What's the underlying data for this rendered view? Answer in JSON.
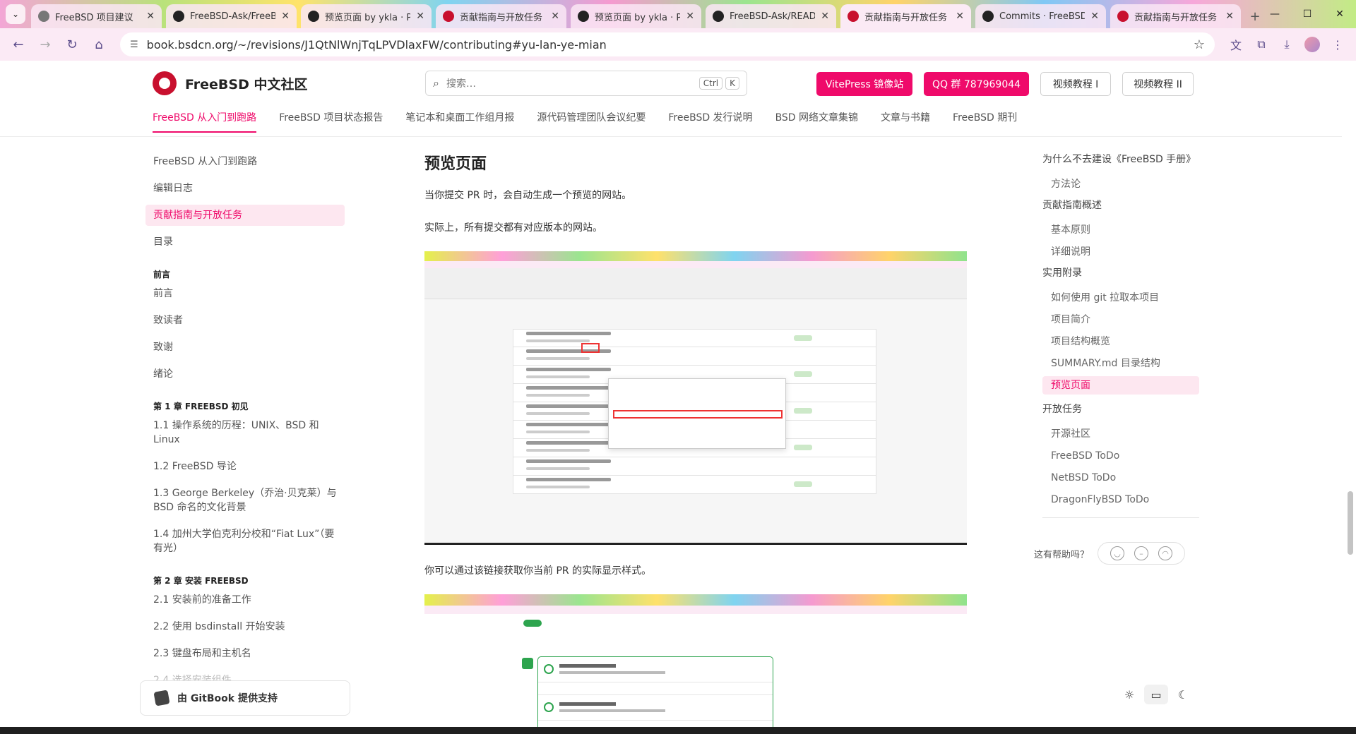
{
  "browser": {
    "tabs": [
      {
        "title": "FreeBSD 项目建议",
        "icon": "globe",
        "active": false
      },
      {
        "title": "FreeBSD-Ask/FreeB",
        "icon": "github",
        "active": false
      },
      {
        "title": "预览页面 by ykla · P",
        "icon": "github",
        "active": false
      },
      {
        "title": "贡献指南与开放任务",
        "icon": "freebsd",
        "active": false
      },
      {
        "title": "预览页面 by ykla · P",
        "icon": "github",
        "active": false
      },
      {
        "title": "FreeBSD-Ask/READ",
        "icon": "github",
        "active": false
      },
      {
        "title": "贡献指南与开放任务",
        "icon": "freebsd",
        "active": true
      },
      {
        "title": "Commits · FreeBSD",
        "icon": "github",
        "active": false
      },
      {
        "title": "贡献指南与开放任务",
        "icon": "freebsd",
        "active": false
      }
    ],
    "url": "book.bsdcn.org/~/revisions/J1QtNlWnjTqLPVDlaxFW/contributing#yu-lan-ye-mian"
  },
  "header": {
    "site_name": "FreeBSD 中文社区",
    "search_placeholder": "搜索…",
    "search_kbd_ctrl": "Ctrl",
    "search_kbd_k": "K",
    "btn_vitepress": "VitePress 镜像站",
    "btn_qq": "QQ 群 787969044",
    "btn_video1": "视频教程 I",
    "btn_video2": "视频教程 II",
    "nav": [
      "FreeBSD 从入门到跑路",
      "FreeBSD 项目状态报告",
      "笔记本和桌面工作组月报",
      "源代码管理团队会议纪要",
      "FreeBSD 发行说明",
      "BSD 网络文章集锦",
      "文章与书籍",
      "FreeBSD 期刊"
    ]
  },
  "sidebar": {
    "top_items": [
      "FreeBSD 从入门到跑路",
      "编辑日志",
      "贡献指南与开放任务",
      "目录"
    ],
    "sec_preface": "前言",
    "preface_items": [
      "前言",
      "致读者",
      "致谢",
      "绪论"
    ],
    "sec_ch1": "第 1 章 FREEBSD 初见",
    "ch1_items": [
      "1.1 操作系统的历程：UNIX、BSD 和 Linux",
      "1.2 FreeBSD 导论",
      "1.3 George Berkeley（乔治·贝克莱）与 BSD 命名的文化背景",
      "1.4 加州大学伯克利分校和“Fiat Lux”（要有光）"
    ],
    "sec_ch2": "第 2 章 安装 FREEBSD",
    "ch2_items": [
      "2.1 安装前的准备工作",
      "2.2 使用 bsdinstall 开始安装",
      "2.3 键盘布局和主机名",
      "2.4 选择安装组件"
    ],
    "gitbook": "由 GitBook 提供支持"
  },
  "main": {
    "heading": "预览页面",
    "p1": "当你提交 PR 时，会自动生成一个预览的网站。",
    "p2": "实际上，所有提交都有对应版本的网站。",
    "p3": "你可以通过该链接获取你当前 PR 的实际显示样式。"
  },
  "toc": {
    "items": [
      {
        "text": "为什么不去建设《FreeBSD 手册》",
        "level": 1
      },
      {
        "text": "方法论",
        "level": 2
      },
      {
        "text": "贡献指南概述",
        "level": 1
      },
      {
        "text": "基本原则",
        "level": 2
      },
      {
        "text": "详细说明",
        "level": 2
      },
      {
        "text": "实用附录",
        "level": 1
      },
      {
        "text": "如何使用 git 拉取本项目",
        "level": 2
      },
      {
        "text": "项目简介",
        "level": 2
      },
      {
        "text": "项目结构概览",
        "level": 2
      },
      {
        "text": "SUMMARY.md 目录结构",
        "level": 2
      },
      {
        "text": "预览页面",
        "level": 2,
        "active": true
      },
      {
        "text": "开放任务",
        "level": 1
      },
      {
        "text": "开源社区",
        "level": 2
      },
      {
        "text": "FreeBSD ToDo",
        "level": 2
      },
      {
        "text": "NetBSD ToDo",
        "level": 2
      },
      {
        "text": "DragonFlyBSD ToDo",
        "level": 2
      }
    ],
    "helpful": "这有帮助吗？"
  },
  "colors": {
    "accent": "#ef0a6a",
    "accent_bg": "#fde7f0"
  }
}
